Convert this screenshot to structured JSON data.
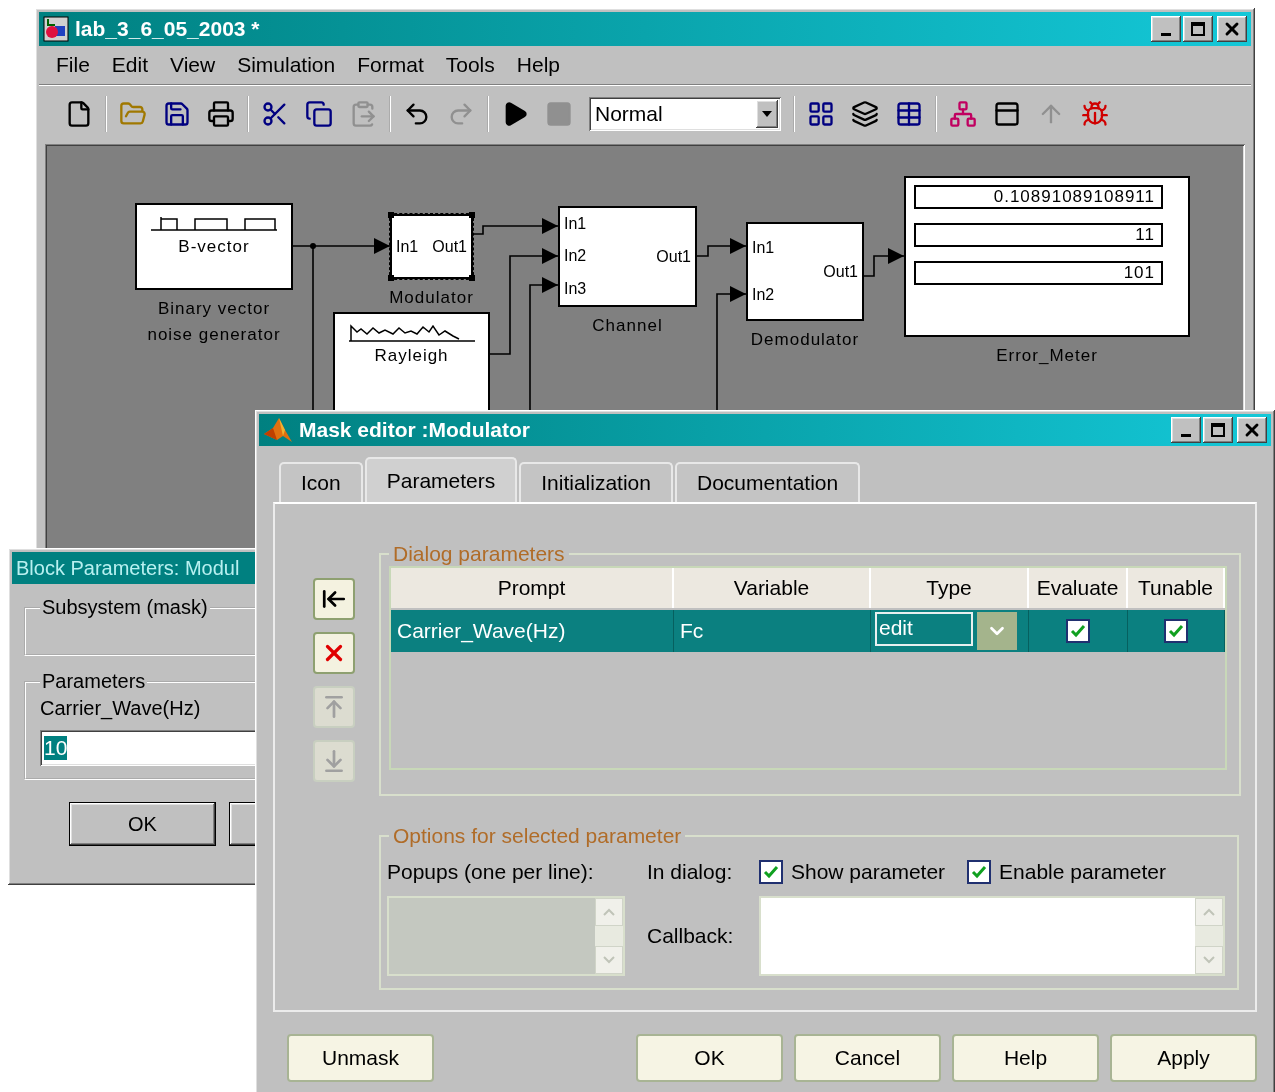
{
  "main_window": {
    "title": "lab_3_6_05_2003 *",
    "menu": [
      "File",
      "Edit",
      "View",
      "Simulation",
      "Format",
      "Tools",
      "Help"
    ],
    "toolbar_groups": [
      [
        {
          "kind": "new",
          "disabled": false
        }
      ],
      [
        {
          "kind": "open",
          "disabled": false
        },
        {
          "kind": "save",
          "disabled": false
        },
        {
          "kind": "print",
          "disabled": false
        }
      ],
      [
        {
          "kind": "cut",
          "disabled": false
        },
        {
          "kind": "copy",
          "disabled": false
        },
        {
          "kind": "paste",
          "disabled": true
        }
      ],
      [
        {
          "kind": "undo",
          "disabled": false
        },
        {
          "kind": "redo",
          "disabled": true
        }
      ],
      [
        {
          "kind": "start",
          "disabled": false
        },
        {
          "kind": "stop",
          "disabled": true
        },
        {
          "kind": "dropdown",
          "value": "Normal"
        }
      ],
      [
        {
          "kind": "library",
          "disabled": false
        },
        {
          "kind": "update",
          "disabled": false
        },
        {
          "kind": "build",
          "disabled": false
        }
      ],
      [
        {
          "kind": "browser",
          "disabled": false
        },
        {
          "kind": "properties",
          "disabled": false
        },
        {
          "kind": "parent",
          "disabled": true
        },
        {
          "kind": "debug",
          "disabled": false
        }
      ]
    ],
    "diagram": {
      "blocks": [
        {
          "kind": "pulse_source",
          "icon_text": "B-vector",
          "label": "Binary vector noise generator",
          "selected": false
        },
        {
          "kind": "subsystem",
          "ports_in": [
            "In1"
          ],
          "ports_out": [
            "Out1"
          ],
          "label": "Modulator",
          "selected": true
        },
        {
          "kind": "noise_source",
          "icon_text": "Rayleigh",
          "selected": false
        },
        {
          "kind": "subsystem",
          "ports_in": [
            "In1",
            "In2",
            "In3"
          ],
          "ports_out": [
            "Out1"
          ],
          "label": "Channel",
          "selected": false
        },
        {
          "kind": "subsystem",
          "ports_in": [
            "In1",
            "In2"
          ],
          "ports_out": [
            "Out1"
          ],
          "label": "Demodulator",
          "selected": false
        },
        {
          "kind": "display",
          "readings": [
            "0.10891089108911",
            "11",
            "101"
          ],
          "label": "Error_Meter",
          "selected": false
        }
      ]
    }
  },
  "block_parameters": {
    "title": "Block Parameters: Modul",
    "description_group": "Subsystem (mask)",
    "parameters_group": "Parameters",
    "field_label": "Carrier_Wave(Hz)",
    "field_value": "10",
    "value_selected": true,
    "buttons": [
      "OK"
    ]
  },
  "mask_editor": {
    "title": "Mask editor :Modulator",
    "tabs": [
      {
        "label": "Icon",
        "selected": false
      },
      {
        "label": "Parameters",
        "selected": true
      },
      {
        "label": "Initialization",
        "selected": false
      },
      {
        "label": "Documentation",
        "selected": false
      }
    ],
    "dialog_group": "Dialog parameters",
    "side_buttons": [
      {
        "kind": "add",
        "disabled": false
      },
      {
        "kind": "delete",
        "disabled": false
      },
      {
        "kind": "move_up",
        "disabled": true
      },
      {
        "kind": "move_down",
        "disabled": true
      }
    ],
    "table": {
      "columns": [
        "Prompt",
        "Variable",
        "Type",
        "Evaluate",
        "Tunable"
      ],
      "rows": [
        {
          "prompt": "Carrier_Wave(Hz)",
          "variable": "Fc",
          "type": "edit",
          "evaluate": true,
          "tunable": true,
          "selected": true
        }
      ]
    },
    "options_group": "Options for selected parameter",
    "popups_label": "Popups (one per line):",
    "popups_disabled": true,
    "in_dialog_label": "In dialog:",
    "checkboxes": [
      {
        "label": "Show parameter",
        "checked": true
      },
      {
        "label": "Enable parameter",
        "checked": true
      }
    ],
    "callback_label": "Callback:",
    "buttons": [
      "Unmask",
      "OK",
      "Cancel",
      "Help",
      "Apply"
    ]
  }
}
